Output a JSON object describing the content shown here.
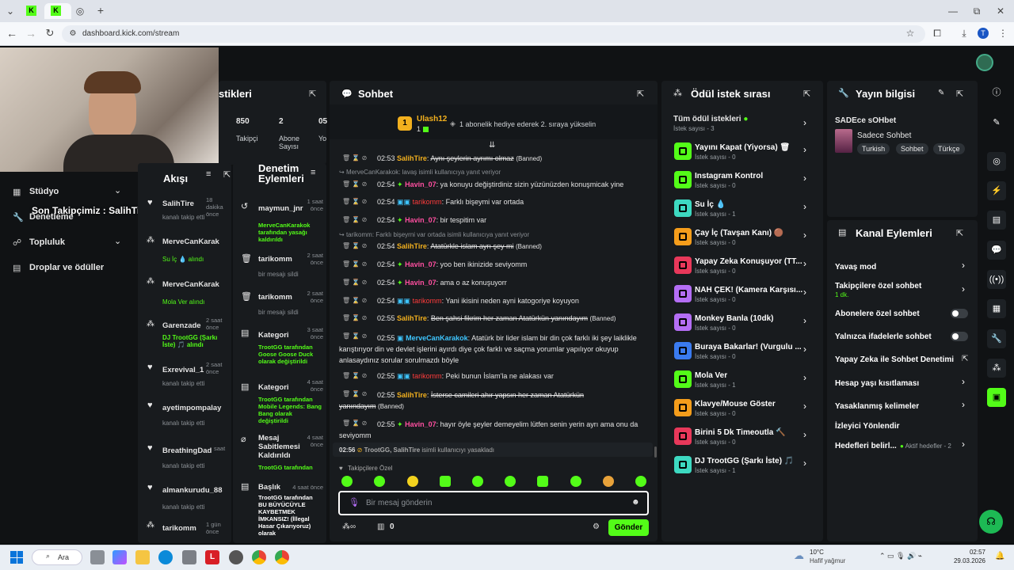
{
  "browser": {
    "url": "dashboard.kick.com/stream",
    "tabs": [
      "K",
      "K"
    ],
    "profile_initial": "T",
    "new_tab": "+",
    "min": "—",
    "restore": "⧉",
    "close": "✕"
  },
  "left_panel": {
    "title_partial": "stikleri",
    "follower_count": "850",
    "follower_label": "Takipçi",
    "sub_count": "2",
    "sub_label": "Abone Sayısı",
    "third_partial": "05",
    "third_label": "Yo"
  },
  "overlay": {
    "banner": "Son Takipçimiz : SalihTire"
  },
  "nav": {
    "items": [
      "Stüdyo",
      "Denetleme",
      "Topluluk",
      "Droplar ve ödüller"
    ]
  },
  "activity": {
    "title": "Akışı",
    "items": [
      {
        "user": "SalihTire",
        "time": "18 dakika önce",
        "desc": "kanalı takip etti",
        "icon": "heart"
      },
      {
        "user": "MerveCanKarak",
        "time": "",
        "desc": "Su İç 💧 alındı",
        "icon": "points"
      },
      {
        "user": "MerveCanKarak",
        "time": "",
        "desc": "Mola Ver alındı",
        "icon": "points"
      },
      {
        "user": "Garenzade",
        "time": "2 saat önce",
        "desc": "DJ TrootGG (Şarkı İste) 🎵 alındı",
        "icon": "points"
      },
      {
        "user": "Exrevival_1",
        "time": "2 saat önce",
        "desc": "kanalı takip etti",
        "icon": "heart"
      },
      {
        "user": "ayetimpompalay",
        "time": "",
        "desc": "kanalı takip etti",
        "icon": "heart"
      },
      {
        "user": "BreathingDad",
        "time": "saat",
        "desc": "kanalı takip etti",
        "icon": "heart"
      },
      {
        "user": "almankurudu_88",
        "time": "",
        "desc": "kanalı takip etti",
        "icon": "heart"
      },
      {
        "user": "tarikomm",
        "time": "1 gün önce",
        "desc": "",
        "icon": "points"
      }
    ]
  },
  "mod_actions": {
    "title": "Denetim Eylemleri",
    "items": [
      {
        "title": "maymun_jnr",
        "time": "1 saat önce",
        "desc": "MerveCanKarakok tarafından yasağı kaldırıldı"
      },
      {
        "title": "tarikomm",
        "time": "2 saat önce",
        "desc": "bir mesajı sildi"
      },
      {
        "title": "tarikomm",
        "time": "2 saat önce",
        "desc": "bir mesajı sildi"
      },
      {
        "title": "Kategori",
        "time": "3 saat önce",
        "desc": "TrootGG tarafından Goose Goose Duck olarak değiştirildi"
      },
      {
        "title": "Kategori",
        "time": "4 saat önce",
        "desc": "TrootGG tarafından Mobile Legends: Bang Bang olarak değiştirildi"
      },
      {
        "title": "Mesaj Sabitlemesi Kaldırıldı",
        "time": "4 saat önce",
        "desc": "TrootGG tarafından"
      },
      {
        "title": "Başlık",
        "time": "4 saat önce",
        "desc": "TrootGG tarafından BU BÜYÜCÜYLE KAYBETMEK İMKANSIZ! (İllegal Hasar Çıkarıyoruz) olarak"
      }
    ]
  },
  "chat": {
    "title": "Sohbet",
    "top_user": "Ulash12",
    "top_count": "1",
    "gift_text": "1 abonelik hediye ederek 2. sıraya yükselin",
    "reply1": "MerveCanKarakok: lavaş isimli kullanıcıya yanıt veriyor",
    "reply2": "tarikomm: Farklı bişeyrni var ortada isimli kullanıcıya yanıt veriyor",
    "messages": [
      {
        "t": "02:53",
        "u": "SalihTire",
        "c": "gold",
        "m": "Aynı şeylerin ayrımı olmaz",
        "banned": "(Banned)",
        "strike": true
      },
      {
        "t": "02:54",
        "u": "Havin_07",
        "c": "pink",
        "m": "ya konuyu değiştirdiniz sizin yüzünüzden konuşmicak yine",
        "banned": "",
        "strike": false
      },
      {
        "t": "02:54",
        "u": "tarikomm",
        "c": "red",
        "m": "Farklı bişeymi var ortada",
        "banned": "",
        "strike": false
      },
      {
        "t": "02:54",
        "u": "Havin_07",
        "c": "pink",
        "m": "bir tespitim var",
        "banned": "",
        "strike": false
      },
      {
        "t": "02:54",
        "u": "SalihTire",
        "c": "gold",
        "m": "Atatürkle islam ayrı şey mi",
        "banned": "(Banned)",
        "strike": true
      },
      {
        "t": "02:54",
        "u": "Havin_07",
        "c": "pink",
        "m": "yoo ben ikinizide seviyomm",
        "banned": "",
        "strike": false
      },
      {
        "t": "02:54",
        "u": "Havin_07",
        "c": "pink",
        "m": "ama o az konuşuyorr",
        "banned": "",
        "strike": false
      },
      {
        "t": "02:54",
        "u": "tarikomm",
        "c": "red",
        "m": "Yani ikisini neden ayni katogoriye koyuyon",
        "banned": "",
        "strike": false
      },
      {
        "t": "02:55",
        "u": "SalihTire",
        "c": "gold",
        "m": "Ben şahsi fikrim her zaman Atatürkün yanındayım",
        "banned": "(Banned)",
        "strike": true
      }
    ],
    "long1_time": "02:55",
    "long1_user": "MerveCanKarakok",
    "long1_a": "Atatürk bir lider islam bir din çok farklı iki şey laiklikle",
    "long1_b": "karıştırıyor din ve devlet işlerini ayırdı diye çok farklı ve saçma yorumlar yapılıyor okuyup",
    "long1_c": "anlasaydınız sorular sorulmazdı böyle",
    "m10_time": "02:55",
    "m10_user": "tarikomm",
    "m10_text": "Peki bunun İslam'la ne alakası var",
    "m11_time": "02:55",
    "m11_user": "SalihTire",
    "m11_text": "İsterse camileri ahır yapsın her zaman Atatürkün",
    "m11_b": "yanındayım",
    "m11_ban": "(Banned)",
    "m12_time": "02:55",
    "m12_user": "Havin_07",
    "m12_text": "hayır öyle şeyler demeyelim lütfen senin yerin ayrı ama onu da",
    "m12_b": "seviyomm",
    "ban_time": "02:56",
    "ban_text": "TrootGG, SalihTire",
    "ban_suffix": "isimli kullanıcıyı yasakladı",
    "followers_only": "Takipçilere Özel",
    "placeholder": "Bir mesaj gönderin",
    "points": "0",
    "send": "Gönder"
  },
  "rewards": {
    "title": "Ödül istek sırası",
    "all": "Tüm ödül istekleri",
    "all_count": "İstek sayısı - 3",
    "items": [
      {
        "name": "Yayını Kapat (Yiyorsa) 🗑",
        "count": "İstek sayısı - 0",
        "color": "#53fc18"
      },
      {
        "name": "Instagram Kontrol",
        "count": "İstek sayısı - 0",
        "color": "#53fc18"
      },
      {
        "name": "Su İç 💧",
        "count": "İstek sayısı - 1",
        "color": "#3dd9c1"
      },
      {
        "name": "Çay İç (Tavşan Kanı) 🟤",
        "count": "İstek sayısı - 0",
        "color": "#f59d1b"
      },
      {
        "name": "Yapay Zeka Konuşuyor (TT...",
        "count": "İstek sayısı - 0",
        "color": "#e8385a"
      },
      {
        "name": "NAH ÇEK! (Kamera Karşısı...",
        "count": "İstek sayısı - 0",
        "color": "#b46ef5"
      },
      {
        "name": "Monkey Banla (10dk)",
        "count": "İstek sayısı - 0",
        "color": "#b46ef5"
      },
      {
        "name": "Buraya Bakarlar! (Vurgulu ...",
        "count": "İstek sayısı - 0",
        "color": "#3a7bf0"
      },
      {
        "name": "Mola Ver",
        "count": "İstek sayısı - 1",
        "color": "#53fc18"
      },
      {
        "name": "Klavye/Mouse Göster",
        "count": "İstek sayısı - 0",
        "color": "#f59d1b"
      },
      {
        "name": "Birini 5 Dk Timeoutla 🔨",
        "count": "İstek sayısı - 0",
        "color": "#e8385a"
      },
      {
        "name": "DJ TrootGG (Şarkı İste) 🎵",
        "count": "İstek sayısı - 1",
        "color": "#3dd9c1"
      }
    ]
  },
  "stream_info": {
    "title": "Yayın bilgisi",
    "stream_title": "SADEce sOHbet",
    "category": "Sadece Sohbet",
    "tags": [
      "Turkish",
      "Sohbet",
      "Türkçe"
    ]
  },
  "channel_actions": {
    "title": "Kanal Eylemleri",
    "items": [
      "Yavaş mod",
      "Takipçilere özel sohbet",
      "Abonelere özel sohbet",
      "Yalnızca ifadelerle sohbet",
      "Yapay Zeka ile Sohbet Denetimi",
      "Hesap yaşı kısıtlaması",
      "Yasaklanmış kelimeler",
      "İzleyici Yönlendir",
      "Hedefleri belirl..."
    ],
    "follower_sub": "1 dk.",
    "goals_sub": "Aktif hedefler - 2"
  },
  "taskbar": {
    "search": "Ara",
    "weather_temp": "10°C",
    "weather_desc": "Hafif yağmur",
    "time": "02:57",
    "date": "29.03.2026"
  }
}
